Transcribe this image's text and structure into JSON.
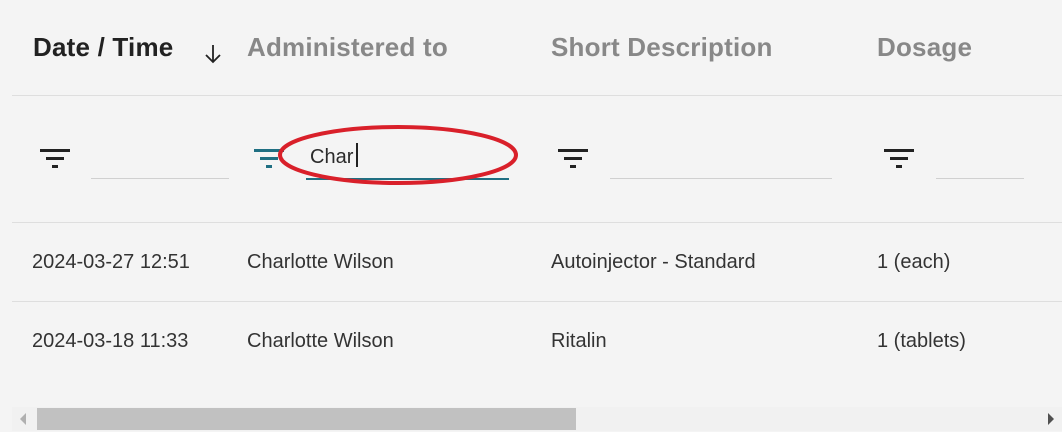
{
  "columns": [
    {
      "label": "Date / Time",
      "sorted": "descending"
    },
    {
      "label": "Administered to"
    },
    {
      "label": "Short Description"
    },
    {
      "label": "Dosage"
    }
  ],
  "filters": {
    "date_value": "",
    "administered_value": "Char",
    "description_value": "",
    "dosage_value": ""
  },
  "rows": [
    {
      "datetime": "2024-03-27 12:51",
      "administered_to": "Charlotte Wilson",
      "description": "Autoinjector - Standard",
      "dosage": "1 (each)"
    },
    {
      "datetime": "2024-03-18 11:33",
      "administered_to": "Charlotte Wilson",
      "description": "Ritalin",
      "dosage": "1 (tablets)"
    }
  ],
  "colors": {
    "active_filter": "#1f6f82",
    "highlight": "#d9202a"
  }
}
